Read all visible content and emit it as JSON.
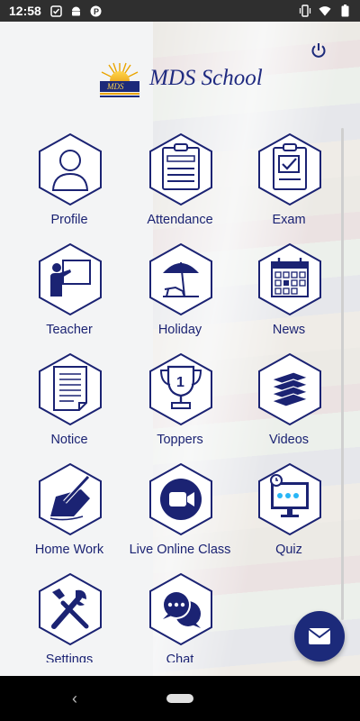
{
  "status_bar": {
    "time": "12:58",
    "left_icons": [
      "square-check-icon",
      "android-icon",
      "p-icon"
    ],
    "right_icons": [
      "vibrate-icon",
      "wifi-icon",
      "battery-icon"
    ]
  },
  "header": {
    "logo_text": "MDS",
    "title": "MDS School",
    "power_icon": "power-icon"
  },
  "colors": {
    "primary": "#1c2a7a",
    "hex_border": "#1b2373",
    "label": "#1b2373"
  },
  "menu": [
    {
      "label": "Profile",
      "icon": "profile-icon"
    },
    {
      "label": "Attendance",
      "icon": "attendance-icon"
    },
    {
      "label": "Exam",
      "icon": "exam-icon"
    },
    {
      "label": "Teacher",
      "icon": "teacher-icon"
    },
    {
      "label": "Holiday",
      "icon": "holiday-icon"
    },
    {
      "label": "News",
      "icon": "news-icon"
    },
    {
      "label": "Notice",
      "icon": "notice-icon"
    },
    {
      "label": "Toppers",
      "icon": "trophy-icon"
    },
    {
      "label": "Videos",
      "icon": "books-icon"
    },
    {
      "label": "Home Work",
      "icon": "homework-icon"
    },
    {
      "label": "Live Online Class",
      "icon": "video-camera-icon"
    },
    {
      "label": "Quiz",
      "icon": "quiz-icon"
    },
    {
      "label": "Settings",
      "icon": "settings-icon"
    },
    {
      "label": "Chat",
      "icon": "chat-icon"
    }
  ],
  "fab": {
    "icon": "mail-icon"
  },
  "nav": {
    "back_glyph": "‹"
  }
}
